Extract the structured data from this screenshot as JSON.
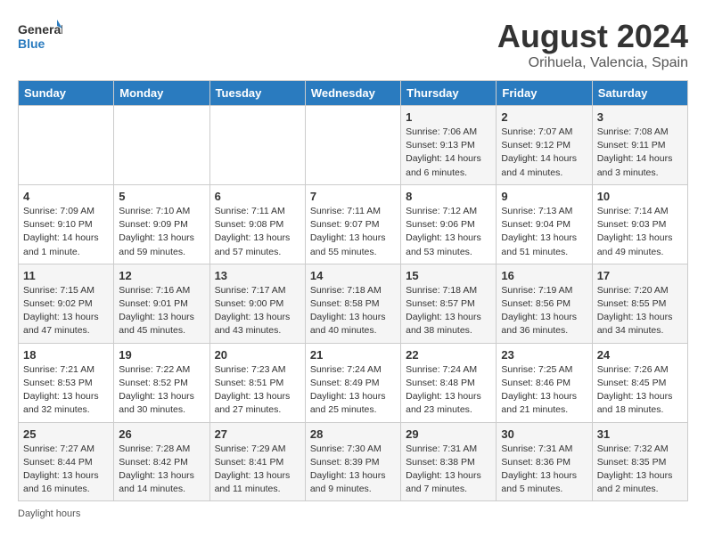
{
  "header": {
    "logo_general": "General",
    "logo_blue": "Blue",
    "month_title": "August 2024",
    "location": "Orihuela, Valencia, Spain"
  },
  "days_of_week": [
    "Sunday",
    "Monday",
    "Tuesday",
    "Wednesday",
    "Thursday",
    "Friday",
    "Saturday"
  ],
  "footer": {
    "note": "Daylight hours"
  },
  "weeks": [
    [
      {
        "day": "",
        "info": ""
      },
      {
        "day": "",
        "info": ""
      },
      {
        "day": "",
        "info": ""
      },
      {
        "day": "",
        "info": ""
      },
      {
        "day": "1",
        "info": "Sunrise: 7:06 AM\nSunset: 9:13 PM\nDaylight: 14 hours\nand 6 minutes."
      },
      {
        "day": "2",
        "info": "Sunrise: 7:07 AM\nSunset: 9:12 PM\nDaylight: 14 hours\nand 4 minutes."
      },
      {
        "day": "3",
        "info": "Sunrise: 7:08 AM\nSunset: 9:11 PM\nDaylight: 14 hours\nand 3 minutes."
      }
    ],
    [
      {
        "day": "4",
        "info": "Sunrise: 7:09 AM\nSunset: 9:10 PM\nDaylight: 14 hours\nand 1 minute."
      },
      {
        "day": "5",
        "info": "Sunrise: 7:10 AM\nSunset: 9:09 PM\nDaylight: 13 hours\nand 59 minutes."
      },
      {
        "day": "6",
        "info": "Sunrise: 7:11 AM\nSunset: 9:08 PM\nDaylight: 13 hours\nand 57 minutes."
      },
      {
        "day": "7",
        "info": "Sunrise: 7:11 AM\nSunset: 9:07 PM\nDaylight: 13 hours\nand 55 minutes."
      },
      {
        "day": "8",
        "info": "Sunrise: 7:12 AM\nSunset: 9:06 PM\nDaylight: 13 hours\nand 53 minutes."
      },
      {
        "day": "9",
        "info": "Sunrise: 7:13 AM\nSunset: 9:04 PM\nDaylight: 13 hours\nand 51 minutes."
      },
      {
        "day": "10",
        "info": "Sunrise: 7:14 AM\nSunset: 9:03 PM\nDaylight: 13 hours\nand 49 minutes."
      }
    ],
    [
      {
        "day": "11",
        "info": "Sunrise: 7:15 AM\nSunset: 9:02 PM\nDaylight: 13 hours\nand 47 minutes."
      },
      {
        "day": "12",
        "info": "Sunrise: 7:16 AM\nSunset: 9:01 PM\nDaylight: 13 hours\nand 45 minutes."
      },
      {
        "day": "13",
        "info": "Sunrise: 7:17 AM\nSunset: 9:00 PM\nDaylight: 13 hours\nand 43 minutes."
      },
      {
        "day": "14",
        "info": "Sunrise: 7:18 AM\nSunset: 8:58 PM\nDaylight: 13 hours\nand 40 minutes."
      },
      {
        "day": "15",
        "info": "Sunrise: 7:18 AM\nSunset: 8:57 PM\nDaylight: 13 hours\nand 38 minutes."
      },
      {
        "day": "16",
        "info": "Sunrise: 7:19 AM\nSunset: 8:56 PM\nDaylight: 13 hours\nand 36 minutes."
      },
      {
        "day": "17",
        "info": "Sunrise: 7:20 AM\nSunset: 8:55 PM\nDaylight: 13 hours\nand 34 minutes."
      }
    ],
    [
      {
        "day": "18",
        "info": "Sunrise: 7:21 AM\nSunset: 8:53 PM\nDaylight: 13 hours\nand 32 minutes."
      },
      {
        "day": "19",
        "info": "Sunrise: 7:22 AM\nSunset: 8:52 PM\nDaylight: 13 hours\nand 30 minutes."
      },
      {
        "day": "20",
        "info": "Sunrise: 7:23 AM\nSunset: 8:51 PM\nDaylight: 13 hours\nand 27 minutes."
      },
      {
        "day": "21",
        "info": "Sunrise: 7:24 AM\nSunset: 8:49 PM\nDaylight: 13 hours\nand 25 minutes."
      },
      {
        "day": "22",
        "info": "Sunrise: 7:24 AM\nSunset: 8:48 PM\nDaylight: 13 hours\nand 23 minutes."
      },
      {
        "day": "23",
        "info": "Sunrise: 7:25 AM\nSunset: 8:46 PM\nDaylight: 13 hours\nand 21 minutes."
      },
      {
        "day": "24",
        "info": "Sunrise: 7:26 AM\nSunset: 8:45 PM\nDaylight: 13 hours\nand 18 minutes."
      }
    ],
    [
      {
        "day": "25",
        "info": "Sunrise: 7:27 AM\nSunset: 8:44 PM\nDaylight: 13 hours\nand 16 minutes."
      },
      {
        "day": "26",
        "info": "Sunrise: 7:28 AM\nSunset: 8:42 PM\nDaylight: 13 hours\nand 14 minutes."
      },
      {
        "day": "27",
        "info": "Sunrise: 7:29 AM\nSunset: 8:41 PM\nDaylight: 13 hours\nand 11 minutes."
      },
      {
        "day": "28",
        "info": "Sunrise: 7:30 AM\nSunset: 8:39 PM\nDaylight: 13 hours\nand 9 minutes."
      },
      {
        "day": "29",
        "info": "Sunrise: 7:31 AM\nSunset: 8:38 PM\nDaylight: 13 hours\nand 7 minutes."
      },
      {
        "day": "30",
        "info": "Sunrise: 7:31 AM\nSunset: 8:36 PM\nDaylight: 13 hours\nand 5 minutes."
      },
      {
        "day": "31",
        "info": "Sunrise: 7:32 AM\nSunset: 8:35 PM\nDaylight: 13 hours\nand 2 minutes."
      }
    ]
  ]
}
